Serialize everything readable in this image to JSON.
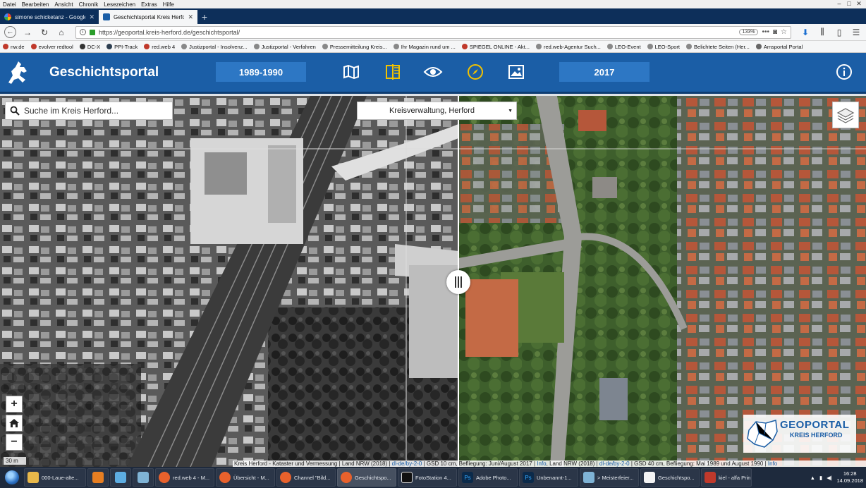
{
  "browser": {
    "menu": [
      "Datei",
      "Bearbeiten",
      "Ansicht",
      "Chronik",
      "Lesezeichen",
      "Extras",
      "Hilfe"
    ],
    "tabs": [
      {
        "title": "simone schicketanz - Google-S",
        "active": false
      },
      {
        "title": "Geschichtsportal Kreis Herford",
        "active": true
      }
    ],
    "url": "https://geoportal.kreis-herford.de/geschichtsportal/",
    "zoom": "133%",
    "bookmarks": [
      "nw.de",
      "evolver redtool",
      "DC-X",
      "PPI-Track",
      "red.web 4",
      "Justizportal - Insolvenz...",
      "Justizportal - Verfahren",
      "Pressemitteilung Kreis...",
      "Ihr Magazin rund um ...",
      "SPIEGEL ONLINE - Akt...",
      "red.web-Agentur Such...",
      "LEO-Event",
      "LEO-Sport",
      "Belichtete Seiten (Her...",
      "Amsportal Portal"
    ]
  },
  "app": {
    "title": "Geschichtsportal",
    "year_left": "1989-1990",
    "year_right": "2017",
    "tools": [
      "map-icon",
      "swipe-compare-icon",
      "eye-icon",
      "compass-icon",
      "image-icon"
    ],
    "accent": "#1b5ea6"
  },
  "map": {
    "search_placeholder": "Suche im Kreis Herford...",
    "place_selected": "Kreisverwaltung, Herford",
    "zoom_in": "+",
    "zoom_out": "−",
    "scale_label": "30 m",
    "logo_line1": "GEOPORTAL",
    "logo_line2": "KREIS HERFORD",
    "attribution": {
      "part1": "Kreis Herford - Kataster und Vermessung | Land NRW (2018) | ",
      "link1": "dl-de/by-2-0",
      "part2": " | GSD 10 cm, Befliegung: Juni/August 2017 | ",
      "link2": "Info",
      "part3": ", Land NRW (2018) | ",
      "link3": "dl-de/by-2-0",
      "part4": " | GSD 40 cm, Befliegung: Mai 1989 und August 1990 | ",
      "link4": "Info"
    }
  },
  "taskbar": {
    "items": [
      "000-Laue-alte...",
      "red.web 4 - M...",
      "Übersicht - M...",
      "Channel \"Bild...",
      "Geschichtspo...",
      "FotoStation 4...",
      "Adobe Photo...",
      "Unbenannt-1...",
      "> Meisterfeier...",
      "Geschichtspo...",
      "kiel - alfa Prin..."
    ],
    "time": "16:28",
    "date": "14.09.2018"
  }
}
